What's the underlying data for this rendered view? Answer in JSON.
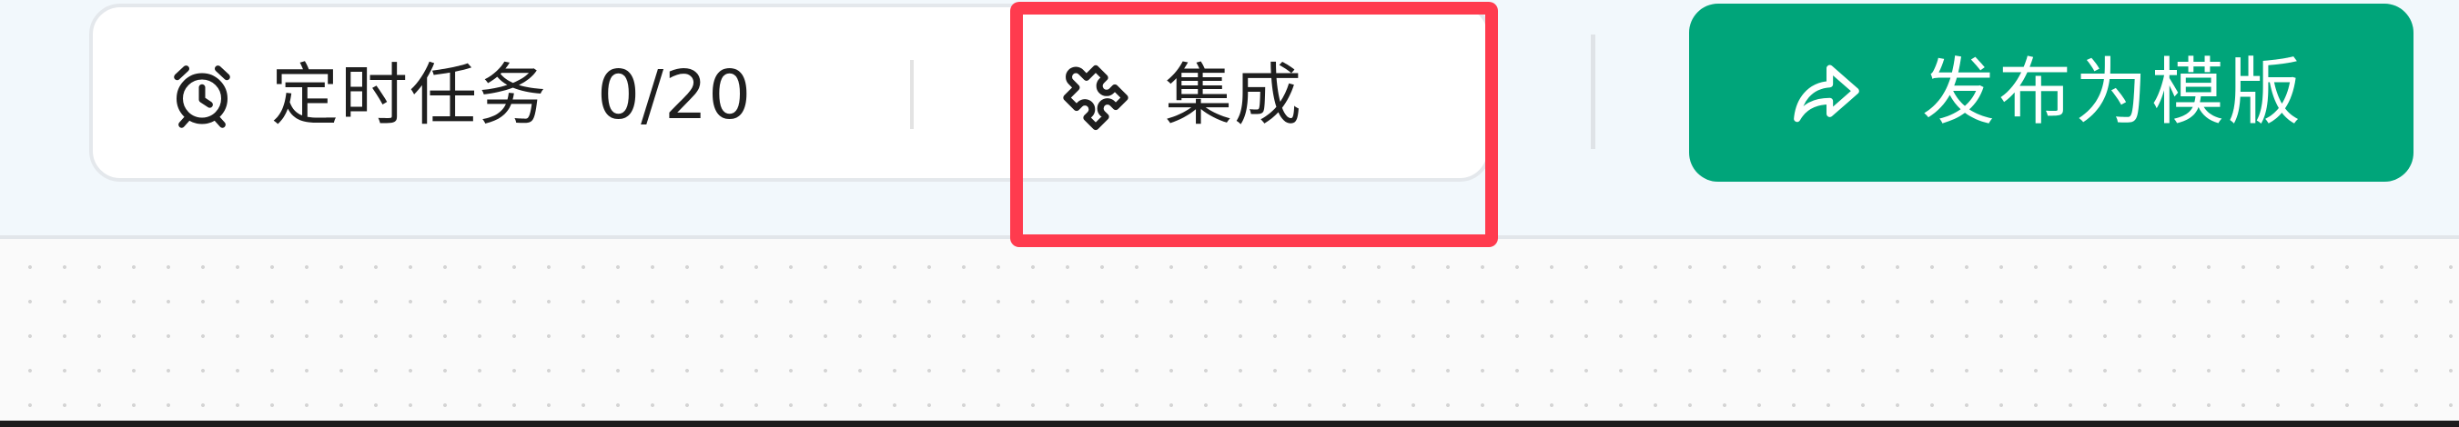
{
  "toolbar": {
    "scheduled_tasks": {
      "icon": "alarm-clock-icon",
      "label": "定时任务",
      "count": "0/20"
    },
    "integration": {
      "icon": "puzzle-piece-icon",
      "label": "集成"
    },
    "publish_button": {
      "icon": "share-arrow-icon",
      "label": "发布为模版"
    }
  },
  "colors": {
    "accent": "#00a57a",
    "highlight": "#ff3b4e",
    "toolbar_background": "#f2f8fc",
    "canvas_background": "#fafafa"
  }
}
